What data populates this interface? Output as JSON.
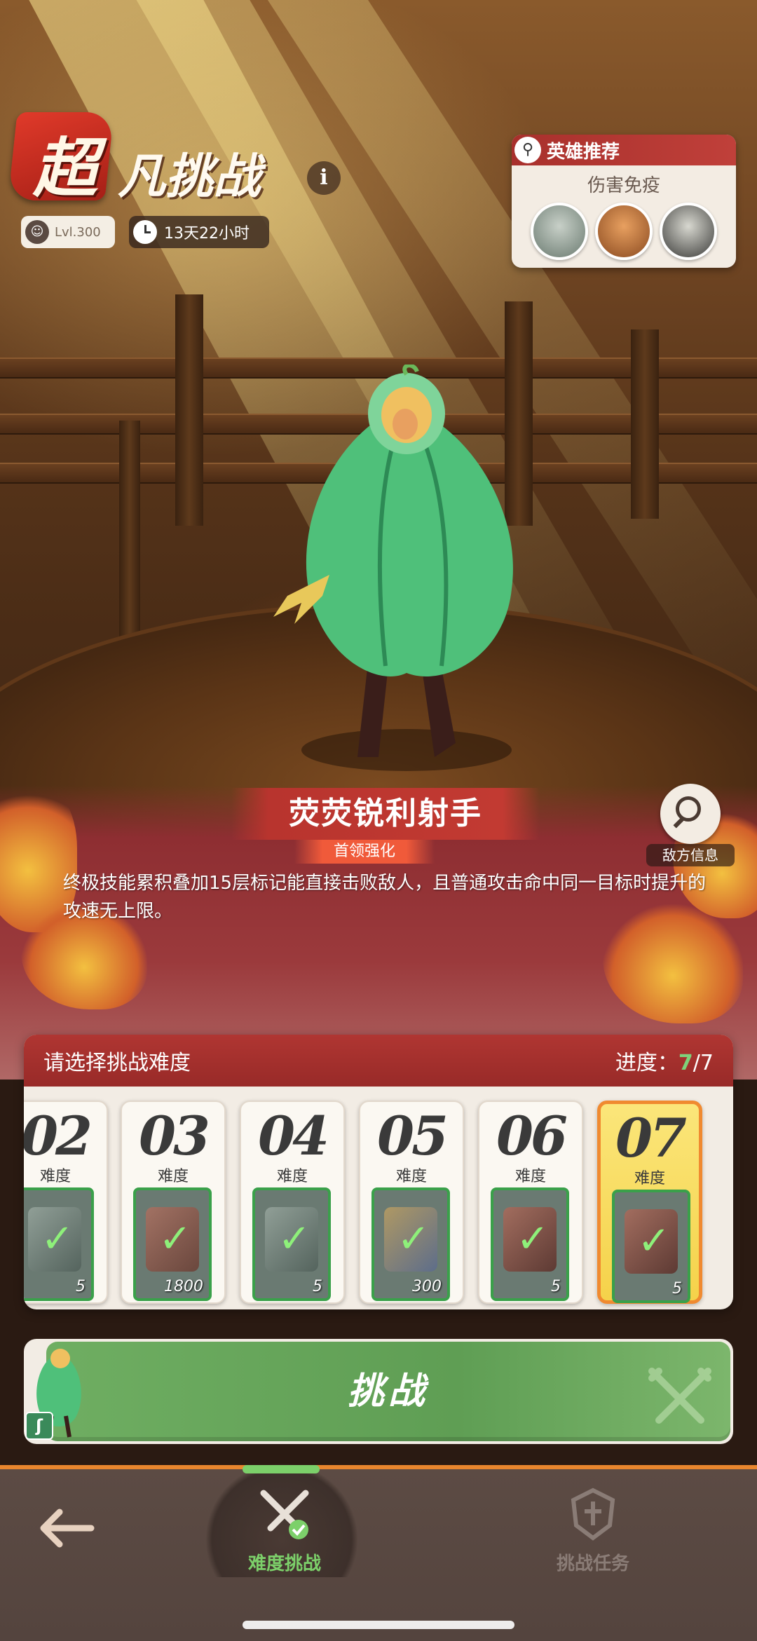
{
  "event": {
    "badge": "超",
    "title": "凡挑战",
    "info": "i"
  },
  "status": {
    "level": "Lvl.300",
    "level_icon": "portrait-icon",
    "timer": "13天22小时"
  },
  "hero_recommend": {
    "header": "英雄推荐",
    "subtitle": "伤害免疫",
    "avatars": [
      "hero-avatar-1",
      "hero-avatar-2",
      "hero-avatar-3"
    ]
  },
  "boss": {
    "name": "荧荧锐利射手",
    "tag": "首领强化",
    "description": "终极技能累积叠加15层标记能直接击败敌人，且普通攻击命中同一目标时提升的攻速无上限。",
    "enemy_info_label": "敌方信息"
  },
  "difficulty": {
    "header": "请选择挑战难度",
    "progress_label": "进度：",
    "progress_current": "7",
    "progress_total": "/7",
    "levels": [
      {
        "num": "02",
        "sub": "难度",
        "qty": "5",
        "selected": false
      },
      {
        "num": "03",
        "sub": "难度",
        "qty": "1800",
        "selected": false
      },
      {
        "num": "04",
        "sub": "难度",
        "qty": "5",
        "selected": false
      },
      {
        "num": "05",
        "sub": "难度",
        "qty": "300",
        "selected": false
      },
      {
        "num": "06",
        "sub": "难度",
        "qty": "5",
        "selected": false
      },
      {
        "num": "07",
        "sub": "难度",
        "qty": "5",
        "selected": true
      }
    ]
  },
  "challenge": {
    "label": "挑战"
  },
  "nav": {
    "difficulty": "难度挑战",
    "tasks": "挑战任务"
  },
  "colors": {
    "accent_red": "#b03632",
    "accent_green": "#6fae62",
    "active_nav": "#7cd06a",
    "inactive_nav": "#8a7c76"
  }
}
